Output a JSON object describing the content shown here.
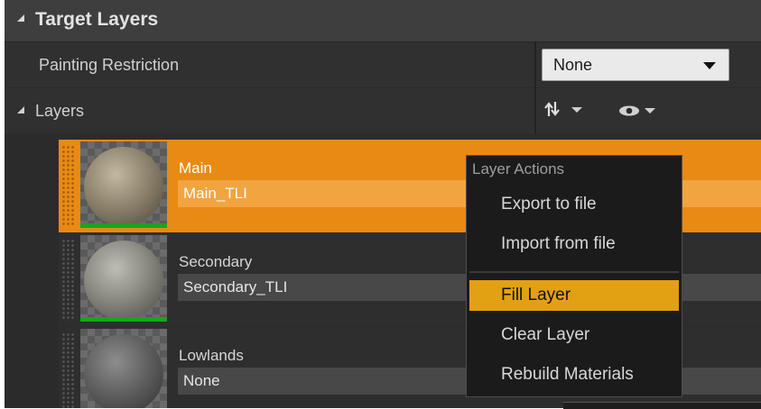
{
  "section": {
    "title": "Target Layers"
  },
  "painting_restriction": {
    "label": "Painting Restriction",
    "value": "None"
  },
  "layers_row": {
    "label": "Layers",
    "sort_icon": "sort-arrows-icon",
    "visibility_icon": "eye-icon"
  },
  "layers": [
    {
      "name": "Main",
      "info": "Main_TLI",
      "selected": true
    },
    {
      "name": "Secondary",
      "info": "Secondary_TLI",
      "selected": false
    },
    {
      "name": "Lowlands",
      "info": "None",
      "selected": false
    }
  ],
  "context_menu": {
    "title": "Layer Actions",
    "items": [
      "Export to file",
      "Import from file",
      "Fill Layer",
      "Clear Layer",
      "Rebuild Materials"
    ],
    "highlighted": "Fill Layer"
  },
  "colors": {
    "selection": "#e88a13",
    "menu_highlight": "#e2a013",
    "layer_bar": "#1aa51a"
  }
}
